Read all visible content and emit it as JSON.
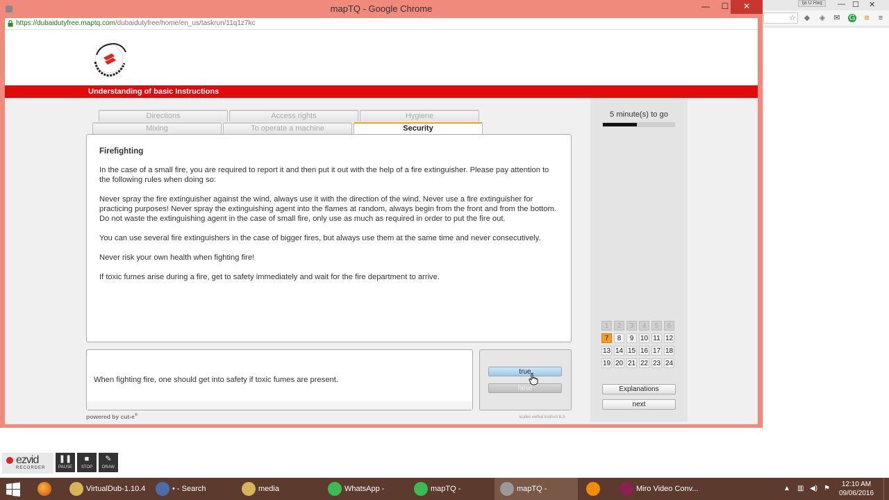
{
  "window": {
    "title": "mapTQ - Google Chrome",
    "url_scheme_host": "https://dubaidutyfree.maptq.com",
    "url_path": "/dubaidutyfree/home/en_us/taskrun/11q1z7kc",
    "minimize": "—",
    "maximize": "☐",
    "close": "✕"
  },
  "page": {
    "header_bar": "Understanding of basic Instructions",
    "tabs_row1": [
      "Directions",
      "Access rights",
      "Hygiene"
    ],
    "tabs_row2": [
      "Mixing",
      "To operate a machine",
      "Security"
    ],
    "active_tab": "Security",
    "text": {
      "heading": "Firefighting",
      "paragraphs": [
        "In the case of a small fire, you are required to report it and then put it out with the help of a fire extinguisher. Please pay attention to the following rules when doing so:",
        "Never spray the fire extinguisher against the wind, always use it with the direction of the wind. Never use a fire extinguisher for practicing purposes! Never spray the extinguishing agent into the flames at random, always begin from the front and from the bottom. Do not waste the extinguishing agent in the case of  small fire, only use as much as required in order to put the fire out.",
        "You can use several fire extinguishers in the case of bigger fires, but always use them at the same time and never consecutively.",
        "Never risk your own health when fighting fire!",
        "If toxic fumes arise during a fire, get to safety immediately and wait for the fire department to arrive."
      ]
    },
    "question": "When fighting fire, one should get into safety if toxic fumes are present.",
    "answer_true": "true",
    "answer_false": "false",
    "powered_by": "powered by cut-e",
    "version": "scales verbal instruct 8.3",
    "timer_text": "5 minute(s) to go",
    "timer_fraction": 0.48,
    "questions": {
      "numbers": [
        "1",
        "2",
        "3",
        "4",
        "5",
        "6",
        "7",
        "8",
        "9",
        "10",
        "11",
        "12",
        "13",
        "14",
        "15",
        "16",
        "17",
        "18",
        "19",
        "20",
        "21",
        "22",
        "23",
        "24"
      ],
      "done": [
        1,
        2,
        3,
        4,
        5,
        6
      ],
      "current": 7
    },
    "explanations_button": "Explanations",
    "next_button": "next"
  },
  "bg_window": {
    "tab_label": "Ija U Haq",
    "min": "—",
    "max": "☐",
    "close": "✕"
  },
  "ezvid": {
    "brand": "ezvid",
    "sub": "RECORDER",
    "pause": "PAUSE",
    "stop": "STOP",
    "draw": "DRAW"
  },
  "taskbar": {
    "items": [
      {
        "label": "VirtualDub-1.10.4",
        "color": "#d8b35a"
      },
      {
        "label": "• - Search Result...",
        "color": "#4a6fa8"
      },
      {
        "label": "media",
        "color": "#d8b35a"
      },
      {
        "label": "WhatsApp - Goo...",
        "color": "#3cba54"
      },
      {
        "label": "mapTQ - Google...",
        "color": "#3cba54"
      },
      {
        "label": "mapTQ - Google...",
        "color": "#999999"
      },
      {
        "label": "",
        "color": "#f28c00"
      },
      {
        "label": "Miro Video Conv...",
        "color": "#8a2250"
      }
    ],
    "time": "12:10 AM",
    "date": "09/06/2016"
  }
}
